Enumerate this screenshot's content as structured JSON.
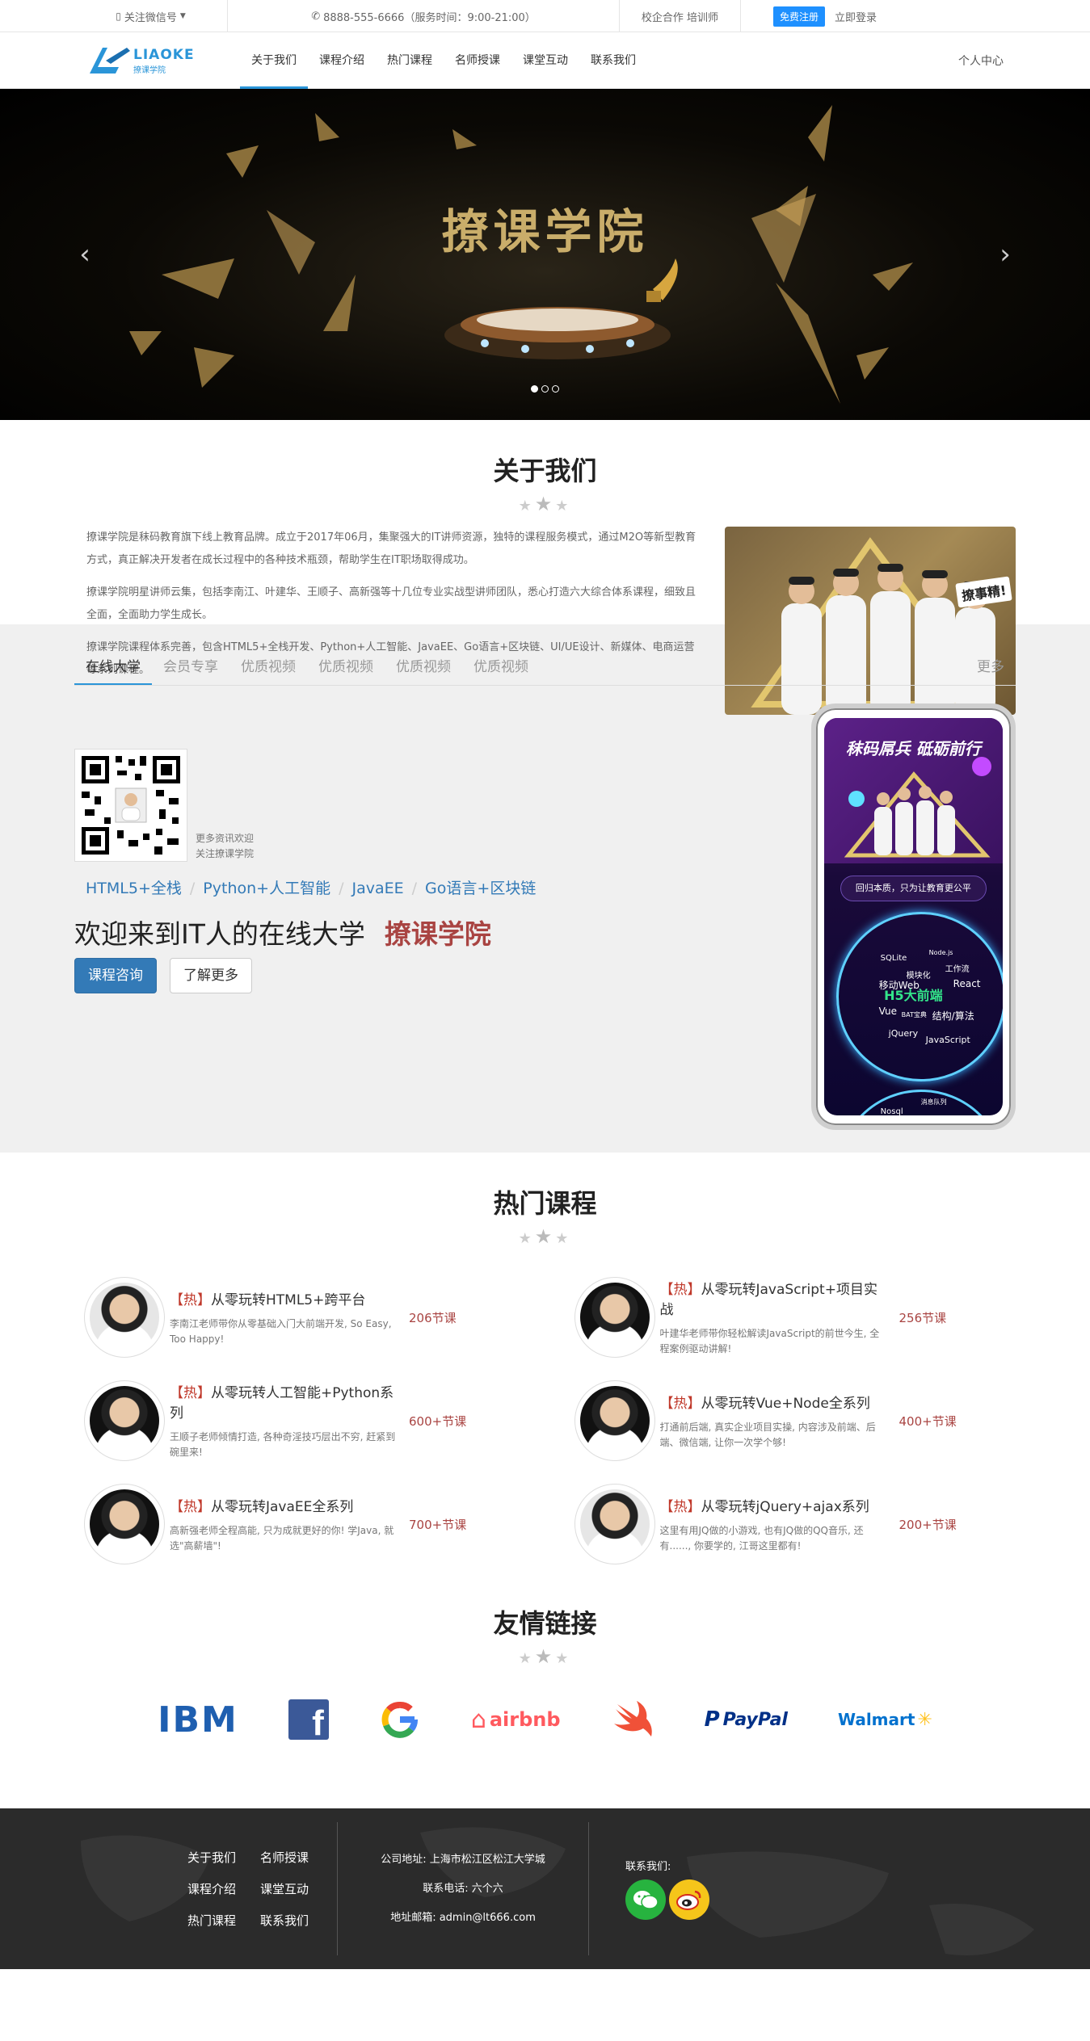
{
  "topbar": {
    "wechat": "关注微信号",
    "phone": "8888-555-6666（服务时间：9:00-21:00）",
    "school": "校企合作 培训师",
    "register": "免费注册",
    "login": "立即登录"
  },
  "nav": {
    "logo_text": "LIAOKE",
    "logo_sub": "撩课学院",
    "items": [
      "关于我们",
      "课程介绍",
      "热门课程",
      "名师授课",
      "课堂互动",
      "联系我们"
    ],
    "user": "个人中心"
  },
  "banner": {
    "title": "撩课学院"
  },
  "about": {
    "title": "关于我们",
    "paragraphs": [
      "撩课学院是秣码教育旗下线上教育品牌。成立于2017年06月，集聚强大的IT讲师资源，独特的课程服务模式，通过M2O等新型教育方式，真正解决开发者在成长过程中的各种技术瓶颈，帮助学生在IT职场取得成功。",
      "撩课学院明星讲师云集，包括李南江、叶建华、王顺子、高新强等十几位专业实战型讲师团队，悉心打造六大综合体系课程，细致且全面，全面助力学生成长。",
      "撩课学院课程体系完善，包含HTML5+全栈开发、Python+人工智能、JavaEE、Go语言+区块链、UI/UE设计、新媒体、电商运营等系列课程。"
    ],
    "badge": "撩事精!"
  },
  "uni": {
    "tabs": [
      "在线大学",
      "会员专享",
      "优质视频",
      "优质视频",
      "优质视频",
      "优质视频"
    ],
    "more": "更多",
    "qr_line1": "更多资讯欢迎",
    "qr_line2": "关注撩课学院",
    "crumbs": [
      "HTML5+全栈",
      "Python+人工智能",
      "JavaEE",
      "Go语言+区块链"
    ],
    "welcome": "欢迎来到IT人的在线大学",
    "brand": "撩课学院",
    "btn_consult": "课程咨询",
    "btn_more": "了解更多",
    "phone_title": "秣码屌兵  砥砺前行",
    "phone_slogan": "回归本质，只为让教育更公平",
    "phone_main": "H5大前端",
    "phone_words": [
      "SQLite",
      "Node.js",
      "模块化",
      "工作流",
      "移动Web",
      "React",
      "Vue",
      "BAT宝典",
      "结构/算法",
      "jQuery",
      "JavaScript",
      "Nosql",
      "消息队列"
    ]
  },
  "hot": {
    "title": "热门课程",
    "courses": [
      {
        "tag": "【热】",
        "name": "从零玩转HTML5+跨平台",
        "desc": "李南江老师带你从零基础入门大前端开发, So Easy, Too Happy!",
        "count": "206节课"
      },
      {
        "tag": "【热】",
        "name": "从零玩转JavaScript+项目实战",
        "desc": "叶建华老师带你轻松解读JavaScript的前世今生, 全程案例驱动讲解!",
        "count": "256节课"
      },
      {
        "tag": "【热】",
        "name": "从零玩转人工智能+Python系列",
        "desc": "王顺子老师倾情打造, 各种奇淫技巧层出不穷, 赶紧到碗里来!",
        "count": "600+节课"
      },
      {
        "tag": "【热】",
        "name": "从零玩转Vue+Node全系列",
        "desc": "打通前后端, 真实企业项目实操, 内容涉及前端、后端、微信端, 让你一次学个够!",
        "count": "400+节课"
      },
      {
        "tag": "【热】",
        "name": "从零玩转JavaEE全系列",
        "desc": "高新强老师全程高能, 只为成就更好的你! 学Java, 就选\"高薪墙\"!",
        "count": "700+节课"
      },
      {
        "tag": "【热】",
        "name": "从零玩转jQuery+ajax系列",
        "desc": "这里有用JQ做的小游戏, 也有JQ做的QQ音乐, 还有......, 你要学的, 江哥这里都有!",
        "count": "200+节课"
      }
    ]
  },
  "links": {
    "title": "友情链接",
    "partners": [
      "IBM",
      "Facebook",
      "Google",
      "airbnb",
      "Swift",
      "PayPal",
      "Walmart"
    ],
    "ibm": "IBM",
    "airbnb": "airbnb",
    "paypal": "PayPal",
    "walmart": "Walmart"
  },
  "footer": {
    "links": [
      "关于我们",
      "名师授课",
      "课程介绍",
      "课堂互动",
      "热门课程",
      "联系我们"
    ],
    "address": "公司地址: 上海市松江区松江大学城",
    "phone": "联系电话: 六个六",
    "email": "地址邮箱: admin@lt666.com",
    "contact_label": "联系我们:"
  },
  "colors": {
    "accent": "#2a95d8",
    "primary_btn": "#337ab7",
    "hot_red": "#a94442",
    "register_blue": "#1e90ff",
    "footer_bg": "#2b2b2b"
  }
}
